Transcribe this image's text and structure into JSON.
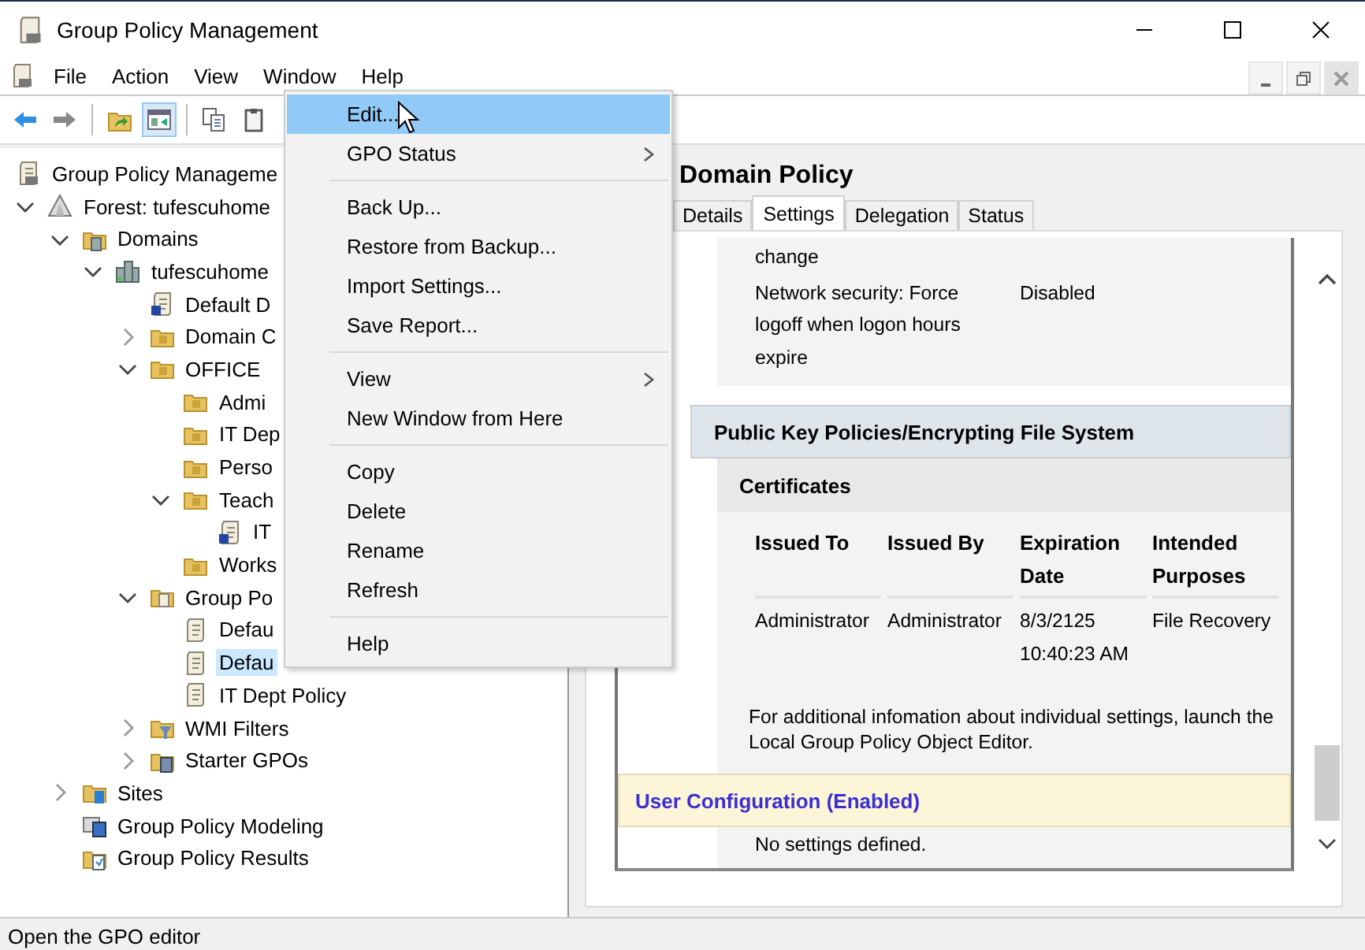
{
  "window": {
    "title": "Group Policy Management"
  },
  "menu_bar": [
    "File",
    "Action",
    "View",
    "Window",
    "Help"
  ],
  "toolbar": [
    {
      "kind": "back",
      "pressed": false
    },
    {
      "kind": "forward",
      "pressed": false
    },
    {
      "kind": "separator"
    },
    {
      "kind": "up",
      "pressed": false
    },
    {
      "kind": "tree",
      "pressed": true
    },
    {
      "kind": "separator"
    },
    {
      "kind": "copy",
      "pressed": false
    },
    {
      "kind": "paste",
      "pressed": false
    }
  ],
  "tree": [
    {
      "label": "Group Policy Manageme",
      "kind": "console",
      "selected": false,
      "children": [
        {
          "label": "Forest: tufescuhome",
          "kind": "forest",
          "expanded": true,
          "selected": false,
          "children": [
            {
              "label": "Domains",
              "kind": "domains",
              "expanded": true,
              "selected": false,
              "children": [
                {
                  "label": "tufescuhome",
                  "kind": "domain",
                  "expanded": true,
                  "selected": false,
                  "children": [
                    {
                      "label": "Default D",
                      "kind": "link",
                      "selected": false
                    },
                    {
                      "label": "Domain C",
                      "kind": "ou",
                      "expanded": false,
                      "selected": false
                    },
                    {
                      "label": "OFFICE",
                      "kind": "ou",
                      "expanded": true,
                      "selected": false,
                      "children": [
                        {
                          "label": "Admi",
                          "kind": "ou",
                          "selected": false
                        },
                        {
                          "label": "IT Dep",
                          "kind": "ou",
                          "selected": false
                        },
                        {
                          "label": "Perso",
                          "kind": "ou",
                          "selected": false
                        },
                        {
                          "label": "Teach",
                          "kind": "ou",
                          "expanded": true,
                          "selected": false,
                          "children": [
                            {
                              "label": "IT",
                              "kind": "link",
                              "selected": false
                            }
                          ]
                        },
                        {
                          "label": "Works",
                          "kind": "ou",
                          "selected": false
                        }
                      ]
                    },
                    {
                      "label": "Group Po",
                      "kind": "container",
                      "expanded": true,
                      "selected": false,
                      "children": [
                        {
                          "label": "Defau",
                          "kind": "gpo",
                          "selected": false
                        },
                        {
                          "label": "Defau",
                          "kind": "gpo",
                          "selected": true
                        },
                        {
                          "label": "IT Dept Policy",
                          "kind": "gpo",
                          "selected": false
                        }
                      ]
                    },
                    {
                      "label": "WMI Filters",
                      "kind": "wmi",
                      "expanded": false,
                      "selected": false
                    },
                    {
                      "label": "Starter GPOs",
                      "kind": "starter",
                      "expanded": false,
                      "selected": false
                    }
                  ]
                }
              ]
            },
            {
              "label": "Sites",
              "kind": "sites",
              "expanded": false,
              "selected": false
            },
            {
              "label": "Group Policy Modeling",
              "kind": "modeling",
              "selected": false
            },
            {
              "label": "Group Policy Results",
              "kind": "results",
              "selected": false
            }
          ]
        }
      ]
    }
  ],
  "context_menu": [
    {
      "kind": "item",
      "label": "Edit...",
      "selected": true,
      "submenu": false
    },
    {
      "kind": "item",
      "label": "GPO Status",
      "selected": false,
      "submenu": true
    },
    {
      "kind": "separator"
    },
    {
      "kind": "item",
      "label": "Back Up...",
      "selected": false,
      "submenu": false
    },
    {
      "kind": "item",
      "label": "Restore from Backup...",
      "selected": false,
      "submenu": false
    },
    {
      "kind": "item",
      "label": "Import Settings...",
      "selected": false,
      "submenu": false
    },
    {
      "kind": "item",
      "label": "Save Report...",
      "selected": false,
      "submenu": false
    },
    {
      "kind": "separator"
    },
    {
      "kind": "item",
      "label": "View",
      "selected": false,
      "submenu": true
    },
    {
      "kind": "item",
      "label": "New Window from Here",
      "selected": false,
      "submenu": false
    },
    {
      "kind": "separator"
    },
    {
      "kind": "item",
      "label": "Copy",
      "selected": false,
      "submenu": false
    },
    {
      "kind": "item",
      "label": "Delete",
      "selected": false,
      "submenu": false
    },
    {
      "kind": "item",
      "label": "Rename",
      "selected": false,
      "submenu": false
    },
    {
      "kind": "item",
      "label": "Refresh",
      "selected": false,
      "submenu": false
    },
    {
      "kind": "separator"
    },
    {
      "kind": "item",
      "label": "Help",
      "selected": false,
      "submenu": false
    }
  ],
  "details": {
    "title": "Domain Policy",
    "tabs": [
      {
        "label": "Details",
        "selected": false
      },
      {
        "label": "Settings",
        "selected": true
      },
      {
        "label": "Delegation",
        "selected": false
      },
      {
        "label": "Status",
        "selected": false
      }
    ],
    "report": {
      "policy_rows": [
        {
          "setting": "change"
        },
        {
          "setting": "Network security: Force logoff when logon hours expire",
          "value": "Disabled"
        }
      ],
      "section": "Public Key Policies/Encrypting File System",
      "subsection": "Certificates",
      "table": {
        "columns": [
          "Issued To",
          "Issued By",
          "Expiration Date",
          "Intended Purposes"
        ],
        "rows": [
          [
            "Administrator",
            "Administrator",
            "8/3/2125 10:40:23 AM",
            "File Recovery"
          ]
        ]
      },
      "note": "For additional infomation about individual settings, launch the Local Group Policy Object Editor.",
      "user_configuration": {
        "title": "User Configuration (Enabled)",
        "note": "No settings defined."
      }
    }
  },
  "status_bar": "Open the GPO editor"
}
